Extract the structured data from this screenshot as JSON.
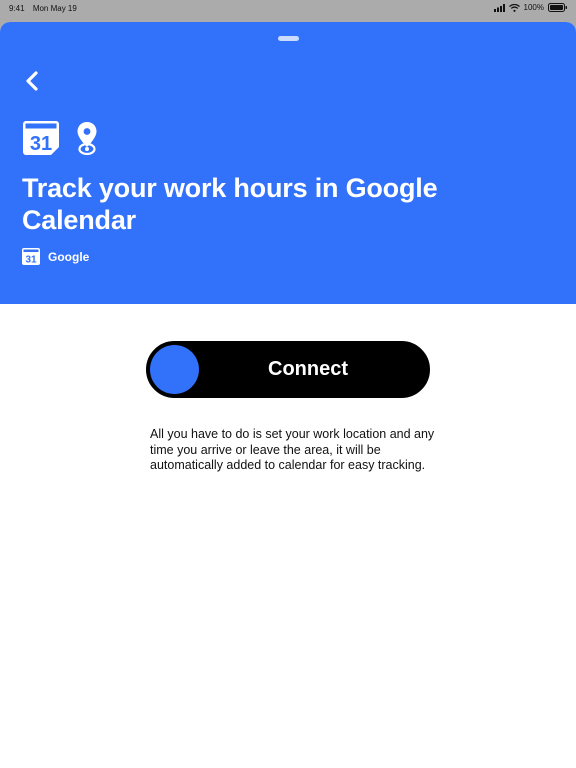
{
  "status_bar": {
    "time": "9:41",
    "date": "Mon May 19",
    "battery": "100%"
  },
  "applet": {
    "title": "Track your work hours in Google Calendar",
    "owner": "Google",
    "calendar_icon_day": "31",
    "description": "All you have to do is set your work location and any time you arrive or leave the area, it will be automatically added to calendar for easy tracking."
  },
  "connect": {
    "label": "Connect"
  },
  "icons": {
    "back": "chevron-left-icon",
    "calendar": "google-calendar-icon",
    "location": "location-pin-icon"
  },
  "colors": {
    "brand_blue": "#3271fa",
    "connect_bg": "#000000"
  }
}
